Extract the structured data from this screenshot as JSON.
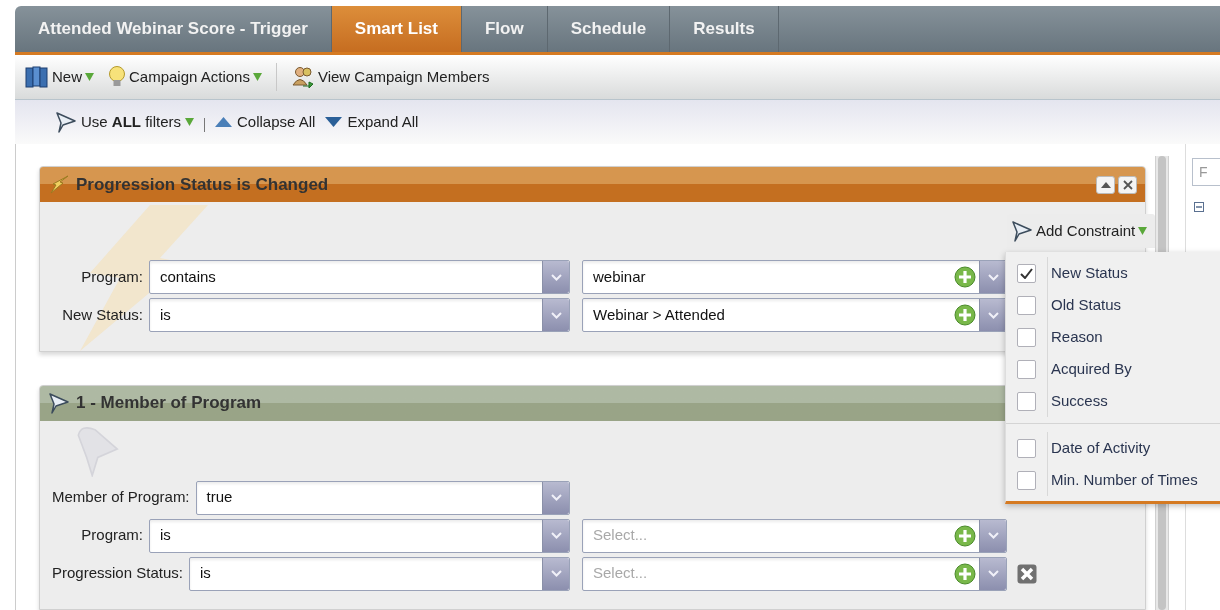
{
  "tabs": [
    {
      "label": "Attended Webinar Score - Trigger",
      "selected": false
    },
    {
      "label": "Smart List",
      "selected": true
    },
    {
      "label": "Flow",
      "selected": false
    },
    {
      "label": "Schedule",
      "selected": false
    },
    {
      "label": "Results",
      "selected": false
    }
  ],
  "toolbar": [
    {
      "label": "New",
      "kind": "new",
      "menu": true
    },
    {
      "label": "Campaign Actions",
      "kind": "actions",
      "menu": true
    },
    {
      "label": "View Campaign Members",
      "kind": "members",
      "menu": false
    }
  ],
  "filter_bar": {
    "logic": "Use **ALL** filters",
    "collapse": "Collapse All",
    "expand": "Expand All"
  },
  "filters": [
    {
      "kind": "trigger",
      "title": "Progression Status is Changed",
      "rows": [
        {
          "label": "Program:",
          "operator": "contains",
          "value": "webinar"
        },
        {
          "label": "New Status:",
          "operator": "is",
          "value": "Webinar > Attended"
        }
      ]
    },
    {
      "kind": "filter",
      "title": "1 - Member of Program",
      "rows": [
        {
          "label": "Member of Program:",
          "operator": "true",
          "deletable": false
        },
        {
          "label": "Program:",
          "operator": "is",
          "placeholder": "Select...",
          "deletable": false
        },
        {
          "label": "Progression Status:",
          "operator": "is",
          "placeholder": "Select...",
          "deletable": true
        }
      ]
    }
  ],
  "add_constraint": {
    "label": "Add Constraint",
    "option_groups": [
      {
        "options": [
          {
            "label": "New Status",
            "checked": true
          },
          {
            "label": "Old Status",
            "checked": false
          },
          {
            "label": "Reason",
            "checked": false
          },
          {
            "label": "Acquired By",
            "checked": false
          },
          {
            "label": "Success",
            "checked": false
          }
        ]
      },
      {
        "options": [
          {
            "label": "Date of Activity",
            "checked": false
          },
          {
            "label": "Min. Number of Times",
            "checked": false
          }
        ]
      }
    ]
  },
  "side_panel": {
    "search_placeholder": "F"
  }
}
